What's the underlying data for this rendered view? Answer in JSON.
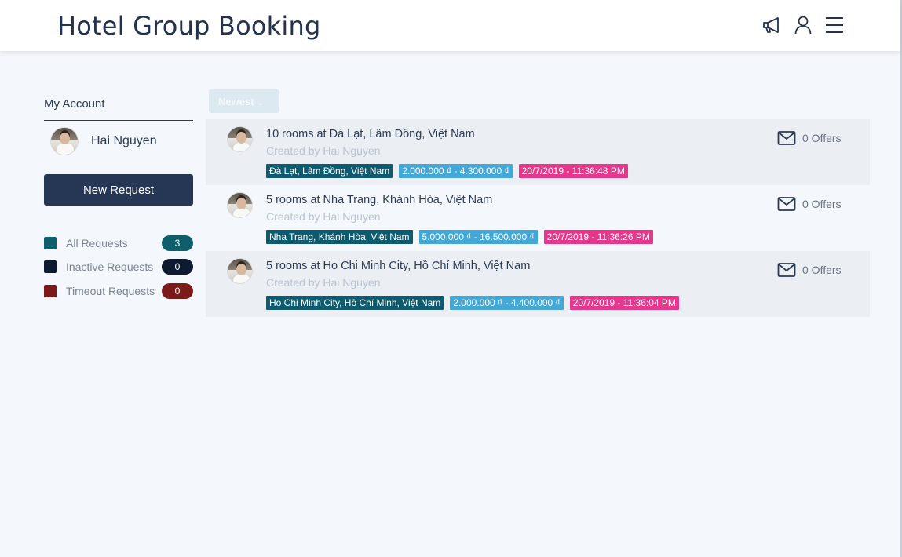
{
  "header": {
    "title": "Hotel Group Booking",
    "icons": [
      "megaphone-icon",
      "user-icon",
      "menu-icon"
    ]
  },
  "sidebar": {
    "heading": "My Account",
    "user_name": "Hai Nguyen",
    "new_request_label": "New Request",
    "filters": [
      {
        "label": "All Requests",
        "count": "3",
        "color": "#0e5f6b"
      },
      {
        "label": "Inactive Requests",
        "count": "0",
        "color": "#0d1a30"
      },
      {
        "label": "Timeout Requests",
        "count": "0",
        "color": "#7c1a1a"
      }
    ]
  },
  "sort": {
    "label": "Newest"
  },
  "requests": [
    {
      "title": "10 rooms at Đà Lạt, Lâm Đồng, Việt Nam",
      "creator": "Created by Hai Nguyen",
      "location": "Đà Lạt, Lâm Đồng, Việt Nam",
      "price": "2.000.000 ₫ - 4.300.000 ₫",
      "date": "20/7/2019 - 11:36:48 PM",
      "offers": "0 Offers"
    },
    {
      "title": "5 rooms at Nha Trang, Khánh Hòa, Việt Nam",
      "creator": "Created by Hai Nguyen",
      "location": "Nha Trang, Khánh Hòa, Việt Nam",
      "price": "5.000.000 ₫ - 16.500.000 ₫",
      "date": "20/7/2019 - 11:36:26 PM",
      "offers": "0 Offers"
    },
    {
      "title": "5 rooms at Ho Chi Minh City, Hồ Chí Minh, Việt Nam",
      "creator": "Created by Hai Nguyen",
      "location": "Ho Chi Minh City, Hồ Chí Minh, Việt Nam",
      "price": "2.000.000 ₫ - 4.400.000 ₫",
      "date": "20/7/2019 - 11:36:04 PM",
      "offers": "0 Offers"
    }
  ],
  "colors": {
    "accent_dark": "#263755",
    "tag_location": "#0e5a6e",
    "tag_price": "#43a8d8",
    "tag_date": "#e6378c"
  }
}
